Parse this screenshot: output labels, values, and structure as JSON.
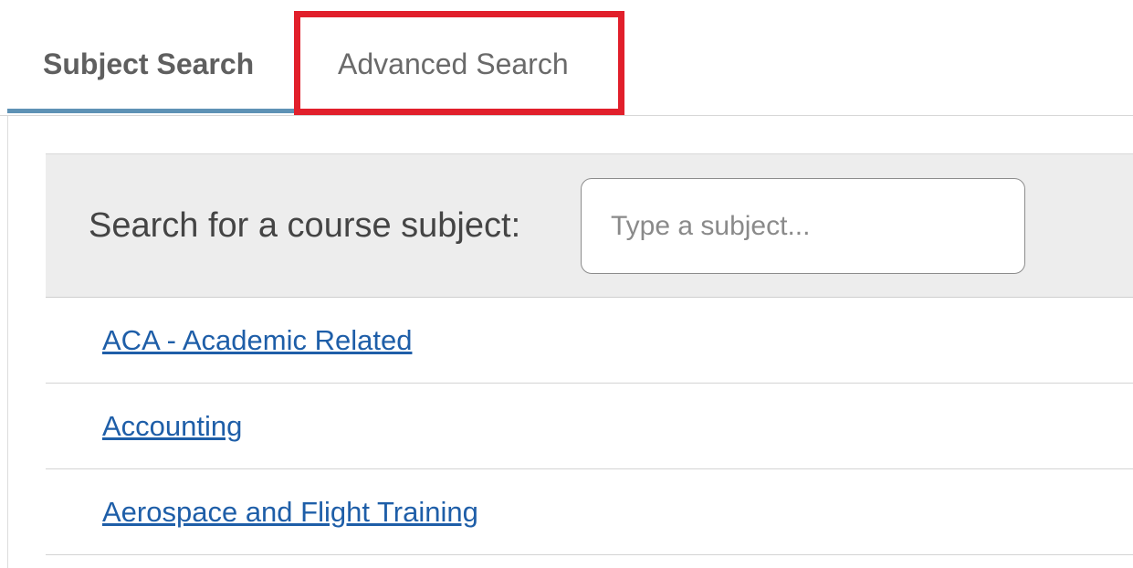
{
  "tabs": {
    "subject_label": "Subject Search",
    "advanced_label": "Advanced Search",
    "active_color": "#5e92b5",
    "highlight_color": "#e11f2b"
  },
  "search": {
    "label": "Search for a course subject:",
    "placeholder": "Type a subject..."
  },
  "subjects": [
    "ACA - Academic Related",
    "Accounting",
    "Aerospace and Flight Training"
  ],
  "colors": {
    "link": "#1e5ea8",
    "search_bar_bg": "#ededed"
  }
}
